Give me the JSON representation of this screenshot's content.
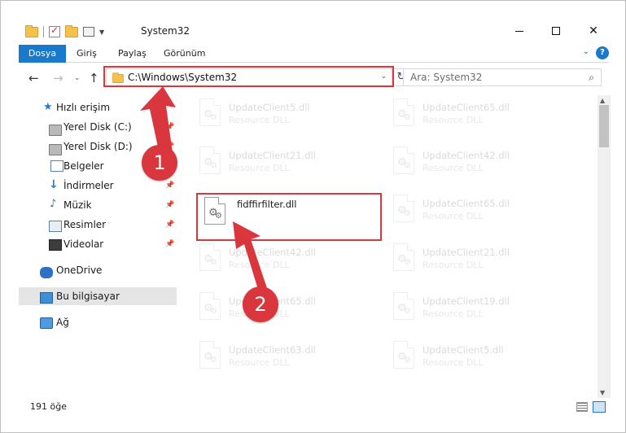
{
  "window": {
    "title": "System32",
    "controls": {
      "minimize": "minimize",
      "maximize": "maximize",
      "close": "✕"
    }
  },
  "ribbon": {
    "tabs": [
      "Dosya",
      "Giriş",
      "Paylaş",
      "Görünüm"
    ],
    "help": "?"
  },
  "nav": {
    "address": "C:\\Windows\\System32",
    "search_placeholder": "Ara: System32"
  },
  "sidebar": {
    "items": [
      {
        "label": "Hızlı erişim",
        "icon": "star-icon",
        "pinned": false
      },
      {
        "label": "Yerel Disk (C:)",
        "icon": "drive-icon",
        "pinned": true
      },
      {
        "label": "Yerel Disk (D:)",
        "icon": "drive-icon",
        "pinned": true
      },
      {
        "label": "Belgeler",
        "icon": "documents-icon",
        "pinned": true
      },
      {
        "label": "İndirmeler",
        "icon": "downloads-icon",
        "pinned": true
      },
      {
        "label": "Müzik",
        "icon": "music-icon",
        "pinned": true
      },
      {
        "label": "Resimler",
        "icon": "pictures-icon",
        "pinned": true
      },
      {
        "label": "Videolar",
        "icon": "videos-icon",
        "pinned": true
      },
      {
        "label": "OneDrive",
        "icon": "onedrive-icon",
        "pinned": false
      },
      {
        "label": "Bu bilgisayar",
        "icon": "this-pc-icon",
        "pinned": false,
        "selected": true
      },
      {
        "label": "Ağ",
        "icon": "network-icon",
        "pinned": false
      }
    ]
  },
  "files": [
    {
      "name": "UpdateClient5.dll",
      "desc": "Resource DLL",
      "faded": true
    },
    {
      "name": "UpdateClient65.dll",
      "desc": "Resource DLL",
      "faded": true
    },
    {
      "name": "UpdateClient21.dll",
      "desc": "Resource DLL",
      "faded": true
    },
    {
      "name": "UpdateClient42.dll",
      "desc": "Resource DLL",
      "faded": true
    },
    {
      "name": "fidffirfilter.dll",
      "desc": "",
      "faded": false
    },
    {
      "name": "UpdateClient65.dll",
      "desc": "Resource DLL",
      "faded": true
    },
    {
      "name": "UpdateClient42.dll",
      "desc": "Resource DLL",
      "faded": true
    },
    {
      "name": "UpdateClient21.dll",
      "desc": "Resource DLL",
      "faded": true
    },
    {
      "name": "UpdateClient65.dll",
      "desc": "Resource DLL",
      "faded": true
    },
    {
      "name": "UpdateClient19.dll",
      "desc": "Resource DLL",
      "faded": true
    },
    {
      "name": "UpdateClient63.dll",
      "desc": "Resource DLL",
      "faded": true
    },
    {
      "name": "UpdateClient5.dll",
      "desc": "Resource DLL",
      "faded": true
    }
  ],
  "status": {
    "item_count": "191 öğe"
  },
  "callouts": {
    "one": "1",
    "two": "2"
  },
  "colors": {
    "accent": "#1979ca",
    "highlight": "#d9363e"
  }
}
